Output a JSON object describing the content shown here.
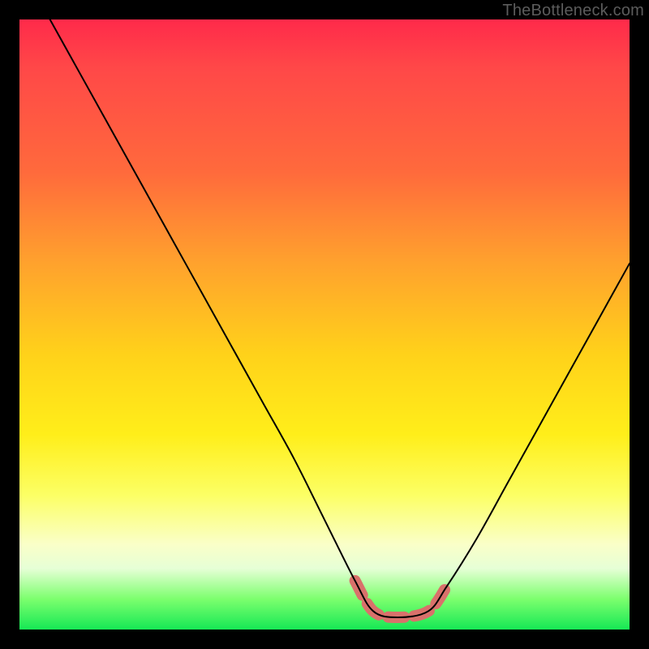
{
  "watermark": "TheBottleneck.com",
  "colors": {
    "frame": "#000000",
    "curve": "#000000",
    "band": "#d9716b",
    "gradient": [
      "#ff2a4a",
      "#ff6a3c",
      "#ffd21a",
      "#fcff65",
      "#16e855"
    ]
  },
  "chart_data": {
    "type": "line",
    "title": "",
    "xlabel": "",
    "ylabel": "",
    "xlim": [
      0,
      100
    ],
    "ylim": [
      0,
      100
    ],
    "grid": false,
    "legend": false,
    "description": "V-shaped bottleneck curve: left branch descends from top-left to a flat trough around x≈55–67, right branch rises toward upper-right. Background is a vertical heat gradient (red top → green bottom). A dashed salmon segment highlights the trough.",
    "series": [
      {
        "name": "bottleneck-curve",
        "x": [
          5,
          10,
          15,
          20,
          25,
          30,
          35,
          40,
          45,
          50,
          55,
          58,
          62,
          67,
          70,
          75,
          80,
          85,
          90,
          95,
          100
        ],
        "y": [
          100,
          91,
          82,
          73,
          64,
          55,
          46,
          37,
          28,
          18,
          8,
          3,
          2,
          3,
          7,
          15,
          24,
          33,
          42,
          51,
          60
        ]
      }
    ],
    "highlight_band": {
      "x_start": 52,
      "x_end": 70
    }
  }
}
